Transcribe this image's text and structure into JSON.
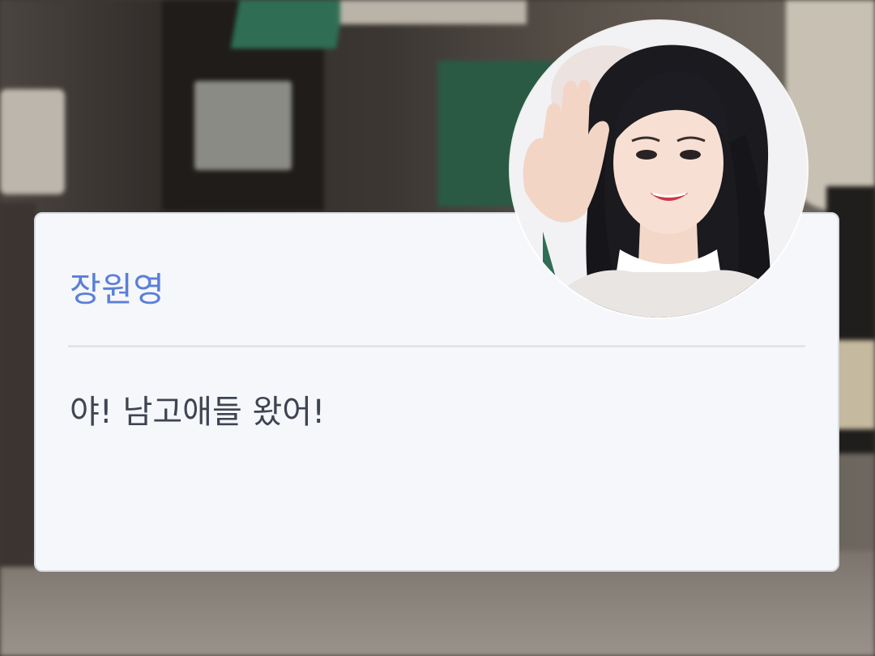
{
  "dialog": {
    "speaker_name": "장원영",
    "message": "야!  남고애들 왔어!"
  },
  "avatar": {
    "icon": "character-portrait"
  },
  "colors": {
    "speaker_name": "#5b7fd9",
    "message_text": "#3f4451",
    "card_background": "#f5f7fa",
    "divider": "#e1e5ea"
  }
}
